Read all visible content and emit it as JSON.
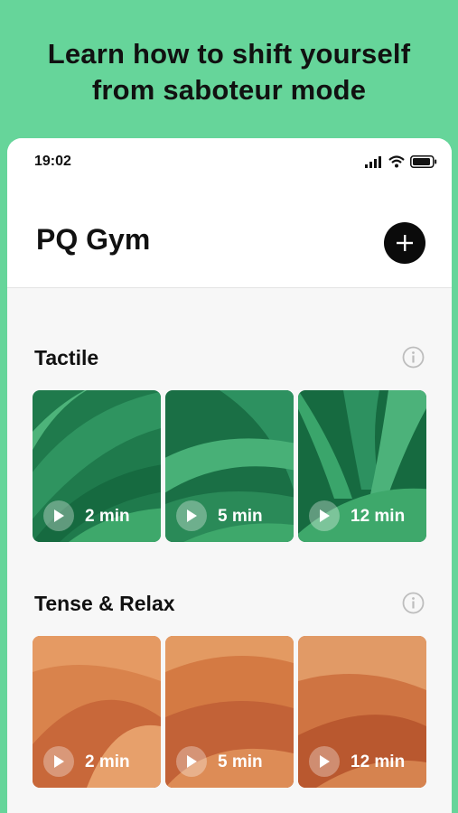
{
  "promo": {
    "line1": "Learn how to shift yourself",
    "line2": "from saboteur mode"
  },
  "status": {
    "time": "19:02"
  },
  "header": {
    "title": "PQ Gym"
  },
  "sections": [
    {
      "title": "Tactile",
      "theme": "leaves",
      "cards": [
        {
          "duration": "2 min"
        },
        {
          "duration": "5 min"
        },
        {
          "duration": "12 min"
        }
      ]
    },
    {
      "title": "Tense & Relax",
      "theme": "desert",
      "cards": [
        {
          "duration": "2 min"
        },
        {
          "duration": "5 min"
        },
        {
          "duration": "12 min"
        }
      ]
    }
  ],
  "colors": {
    "background": "#66d59a",
    "leaf_dark": "#0f5b3a",
    "leaf_light": "#3fa66a",
    "sand_dark": "#b3582a",
    "sand_light": "#e39a62"
  }
}
